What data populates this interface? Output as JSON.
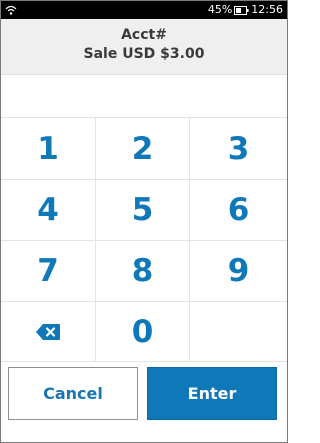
{
  "status_bar": {
    "battery_percent": "45%",
    "time": "12:56",
    "icons": [
      "wifi-icon",
      "battery-icon"
    ]
  },
  "header": {
    "title": "Acct#",
    "subtitle": "Sale USD $3.00",
    "background": "#efefef"
  },
  "keypad": {
    "keys": [
      "1",
      "2",
      "3",
      "4",
      "5",
      "6",
      "7",
      "8",
      "9",
      "",
      "0",
      ""
    ],
    "backspace_icon": "backspace-icon",
    "key_color": "#0f78b8"
  },
  "buttons": {
    "cancel_label": "Cancel",
    "enter_label": "Enter",
    "accent": "#0f78b8"
  }
}
